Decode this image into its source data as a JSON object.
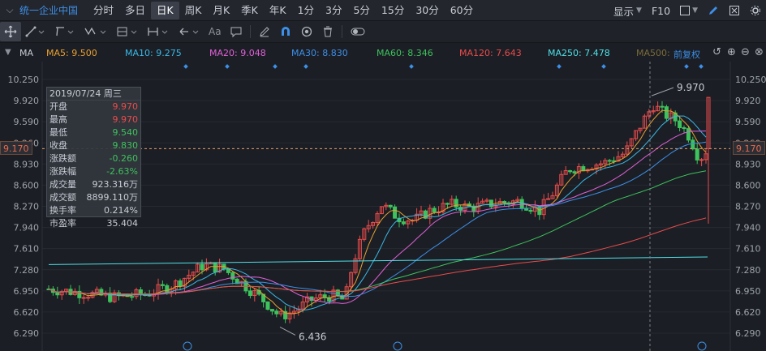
{
  "topbar": {
    "symbol": "统一企业中国",
    "periods": [
      "分时",
      "多日",
      "日K",
      "周K",
      "月K",
      "季K",
      "年K",
      "1分",
      "3分",
      "5分",
      "15分",
      "30分",
      "60分"
    ],
    "active_period": "日K",
    "display_label": "显示",
    "f10_label": "F10"
  },
  "toolbar": {
    "text_tool_label": "Aa"
  },
  "ma_row": {
    "label": "MA",
    "items": [
      {
        "text": "MA5: 9.500",
        "color": "#e8a030"
      },
      {
        "text": "MA10: 9.275",
        "color": "#39b9e8"
      },
      {
        "text": "MA20: 9.048",
        "color": "#e060d8"
      },
      {
        "text": "MA30: 8.830",
        "color": "#3d8fe8"
      },
      {
        "text": "MA60: 8.346",
        "color": "#3ec25d"
      },
      {
        "text": "MA120: 7.643",
        "color": "#e84c4c"
      },
      {
        "text": "MA250: 7.478",
        "color": "#4fe0e8"
      },
      {
        "text": "MA500:",
        "color": "#7a6a3a"
      }
    ],
    "adjust_label": "前复权"
  },
  "axis": {
    "ticks": [
      "10.250",
      "9.920",
      "9.590",
      "9.260",
      "8.930",
      "8.600",
      "8.270",
      "7.940",
      "7.610",
      "7.280",
      "6.950",
      "6.620",
      "6.290"
    ],
    "current_price": "9.170"
  },
  "annotations": {
    "high_label": "9.970",
    "low_label": "6.436"
  },
  "info_panel": {
    "date": "2019/07/24 周三",
    "rows": [
      {
        "k": "开盘",
        "v": "9.970",
        "tone": "up"
      },
      {
        "k": "最高",
        "v": "9.970",
        "tone": "up"
      },
      {
        "k": "最低",
        "v": "9.540",
        "tone": "down"
      },
      {
        "k": "收盘",
        "v": "9.830",
        "tone": "down"
      },
      {
        "k": "涨跌额",
        "v": "-0.260",
        "tone": "down"
      },
      {
        "k": "涨跌幅",
        "v": "-2.63%",
        "tone": "down"
      },
      {
        "k": "成交量",
        "v": "923.316万",
        "tone": ""
      },
      {
        "k": "成交额",
        "v": "8899.110万",
        "tone": ""
      },
      {
        "k": "换手率",
        "v": "0.214%",
        "tone": ""
      },
      {
        "k": "市盈率",
        "v": "35.404",
        "tone": ""
      }
    ]
  },
  "colors": {
    "up": "#e84c4c",
    "down": "#3ec25d",
    "background": "#1b1e24",
    "accent": "#3d8fe8"
  },
  "chart_data": {
    "type": "candlestick",
    "ylim": [
      6.29,
      10.25
    ],
    "ma_start": {
      "ma5": 6.95,
      "ma10": 6.92,
      "ma20": 6.85,
      "ma30": 6.8,
      "ma60": 6.62,
      "ma120": 6.55,
      "ma250": 7.38
    }
  }
}
